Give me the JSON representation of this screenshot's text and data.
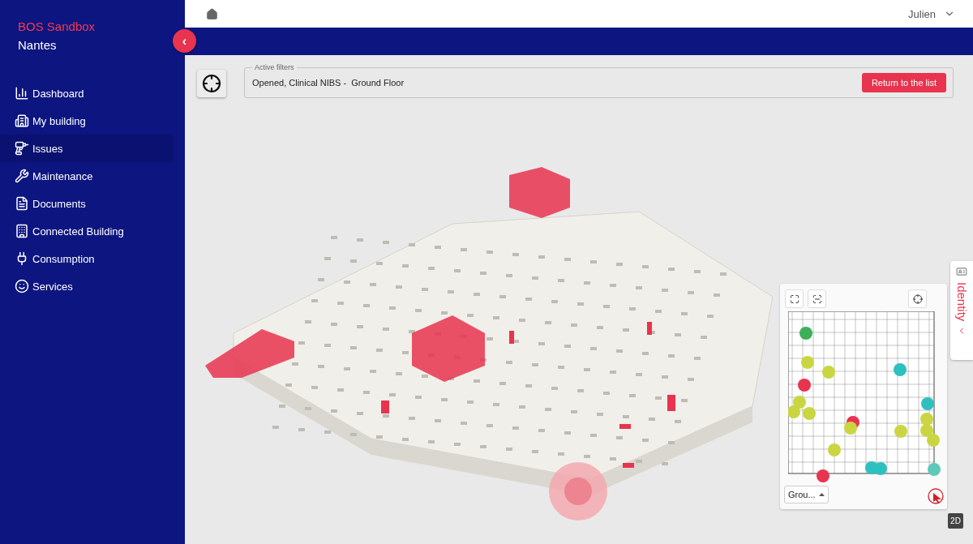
{
  "sidebar": {
    "brand": "BOS Sandbox",
    "site": "Nantes",
    "collapse_label": "‹",
    "items": [
      {
        "label": "Dashboard",
        "selected": false
      },
      {
        "label": "My building",
        "selected": false
      },
      {
        "label": "Issues",
        "selected": true
      },
      {
        "label": "Maintenance",
        "selected": false
      },
      {
        "label": "Documents",
        "selected": false
      },
      {
        "label": "Connected Building",
        "selected": false
      },
      {
        "label": "Consumption",
        "selected": false
      },
      {
        "label": "Services",
        "selected": false
      }
    ]
  },
  "top_bar": {
    "user": "Julien"
  },
  "filters": {
    "legend": "Active filters",
    "value": "Opened, Clinical NIBS -  Ground Floor",
    "button": "Return to the list"
  },
  "minimap": {
    "floor": "Grou...",
    "view_toggle": "2D"
  },
  "side_tab": {
    "label": "Identity"
  }
}
